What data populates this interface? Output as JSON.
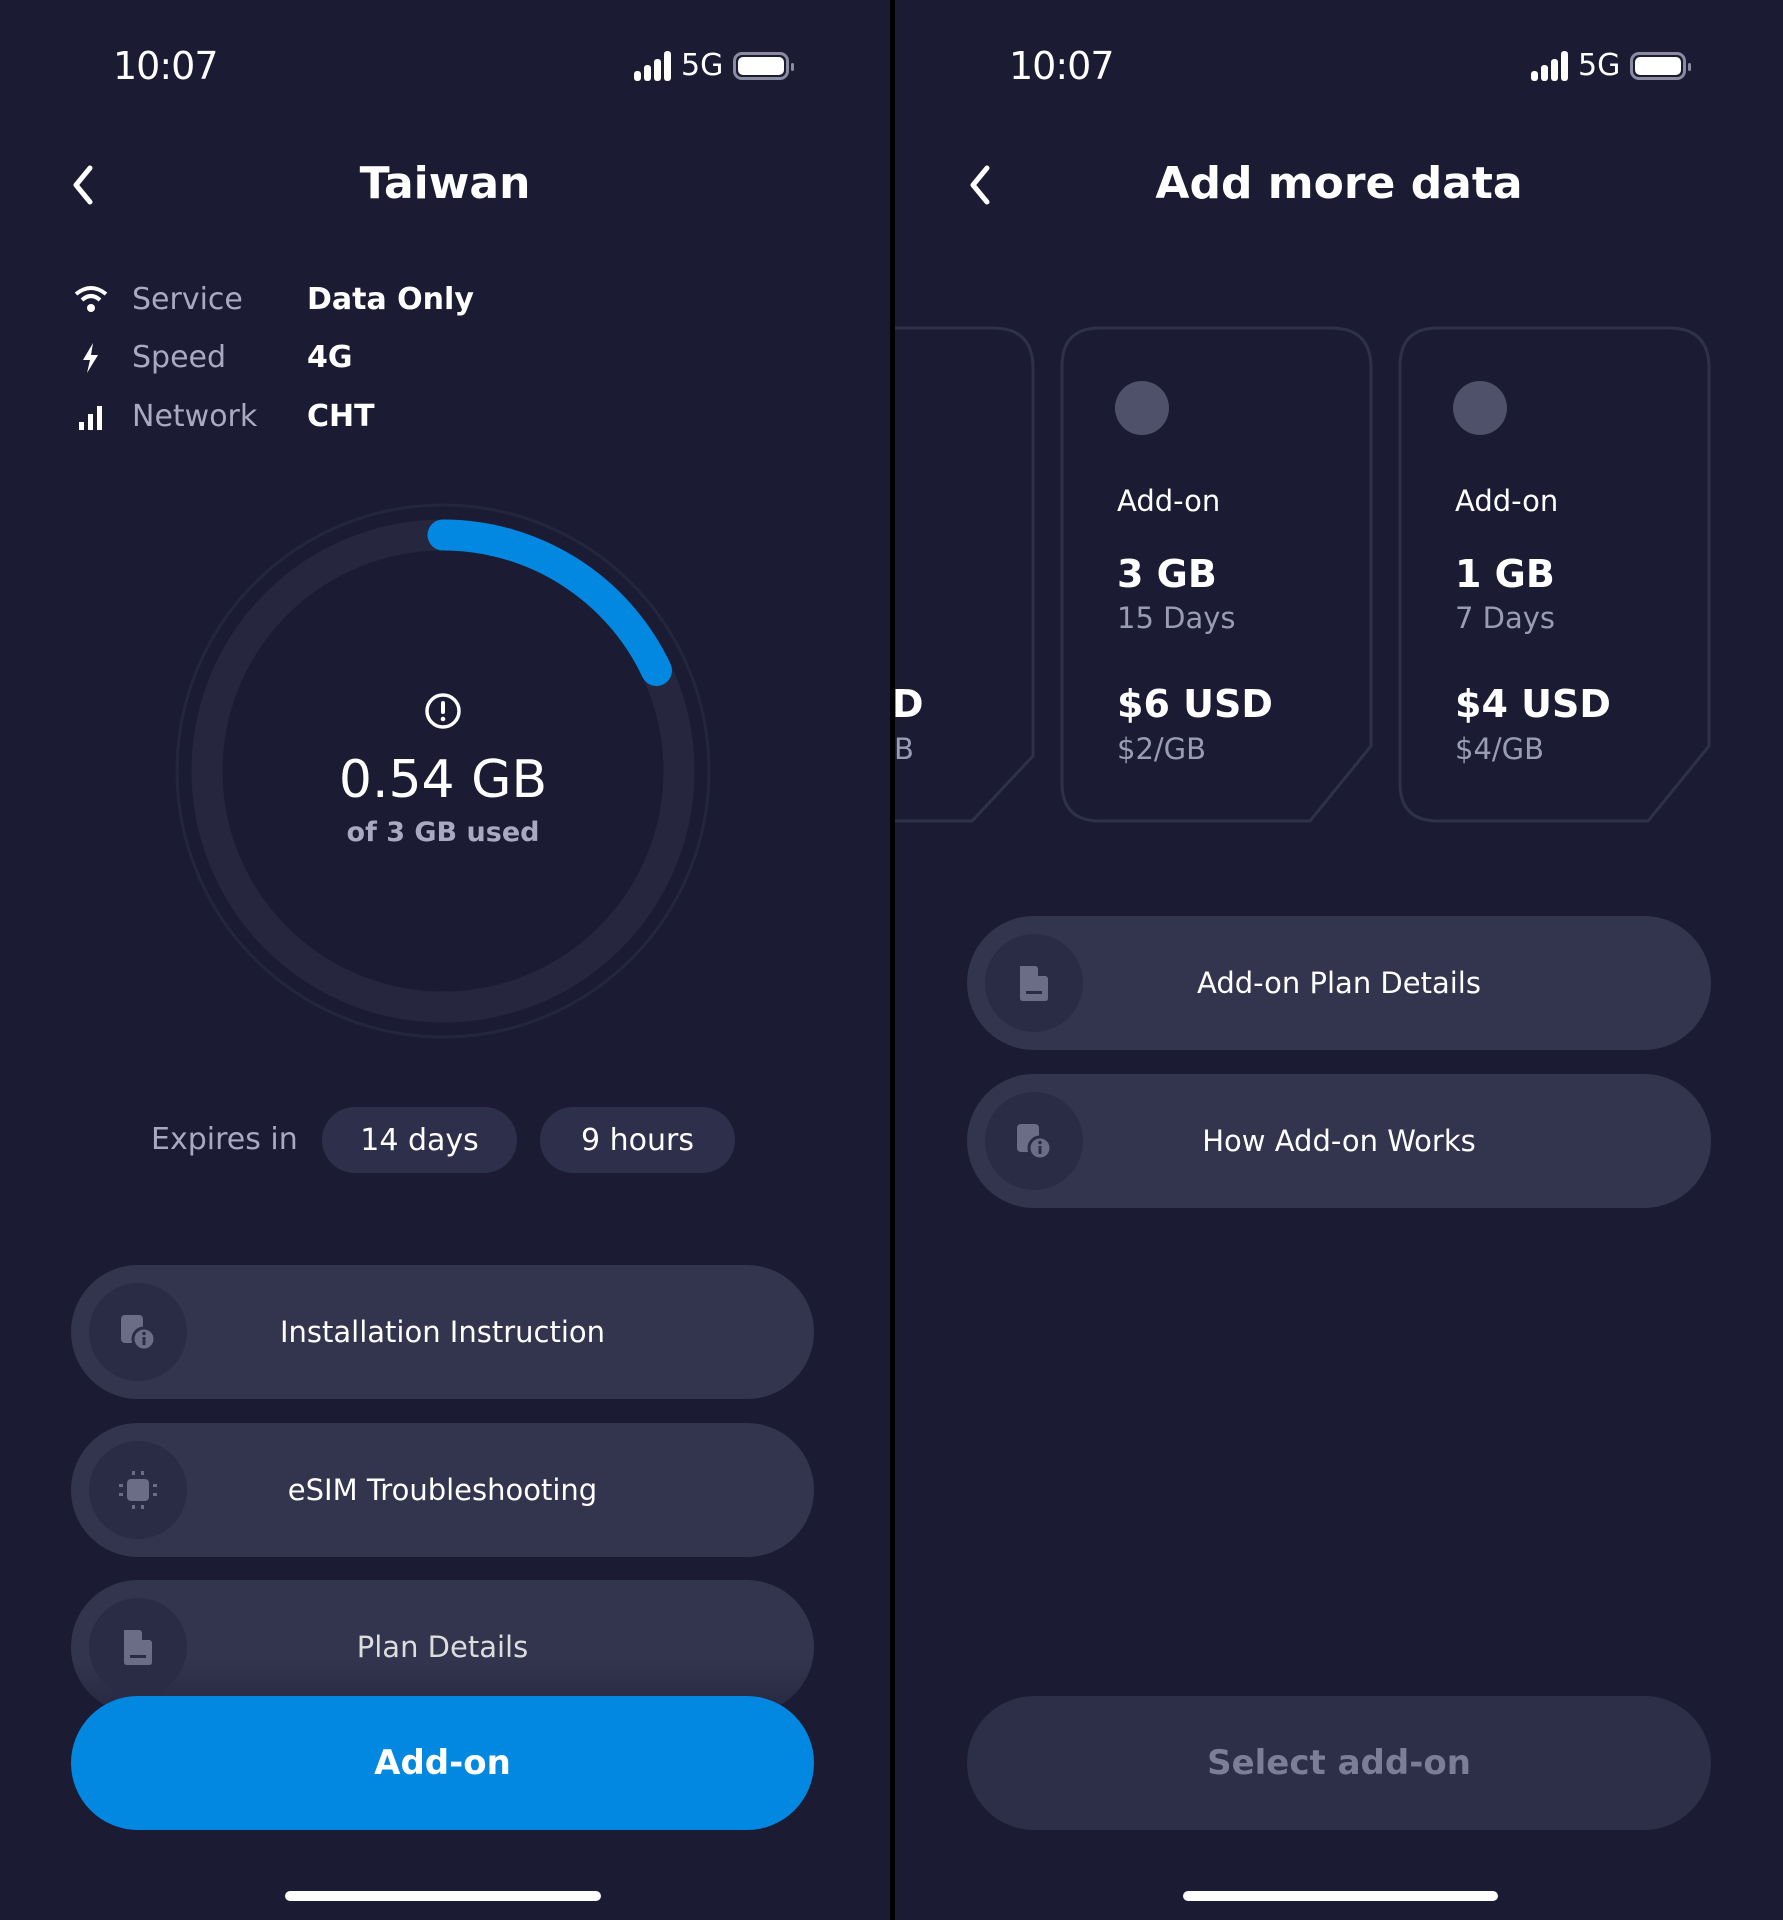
{
  "left": {
    "status": {
      "time": "10:07",
      "network": "5G"
    },
    "title": "Taiwan",
    "info": [
      {
        "icon": "wifi-icon",
        "label": "Service",
        "value": "Data Only"
      },
      {
        "icon": "lightning-icon",
        "label": "Speed",
        "value": "4G"
      },
      {
        "icon": "signal-bars-icon",
        "label": "Network",
        "value": "CHT"
      }
    ],
    "usage": {
      "used": "0.54 GB",
      "caption": "of 3 GB used",
      "used_fraction": 0.18,
      "icon": "alert-circle-icon"
    },
    "expires": {
      "label": "Expires in",
      "days": "14 days",
      "hours": "9 hours"
    },
    "buttons": [
      {
        "label": "Installation Instruction",
        "icon": "device-info-icon"
      },
      {
        "label": "eSIM Troubleshooting",
        "icon": "chip-icon"
      },
      {
        "label": "Plan Details",
        "icon": "document-icon"
      }
    ],
    "primary_button": "Add-on"
  },
  "right": {
    "status": {
      "time": "10:07",
      "network": "5G"
    },
    "title": "Add more data",
    "partial_card": {
      "price_tail": "D",
      "per_tail": "B"
    },
    "cards": [
      {
        "type": "Add-on",
        "data": "3 GB",
        "days": "15 Days",
        "price": "$6 USD",
        "per_gb": "$2/GB"
      },
      {
        "type": "Add-on",
        "data": "1 GB",
        "days": "7 Days",
        "price": "$4 USD",
        "per_gb": "$4/GB"
      }
    ],
    "buttons": [
      {
        "label": "Add-on Plan Details",
        "icon": "document-icon"
      },
      {
        "label": "How Add-on Works",
        "icon": "device-info-icon"
      }
    ],
    "primary_button": "Select add-on"
  },
  "colors": {
    "background": "#1b1c33",
    "accent": "#0288e0",
    "button": "#33344e"
  }
}
